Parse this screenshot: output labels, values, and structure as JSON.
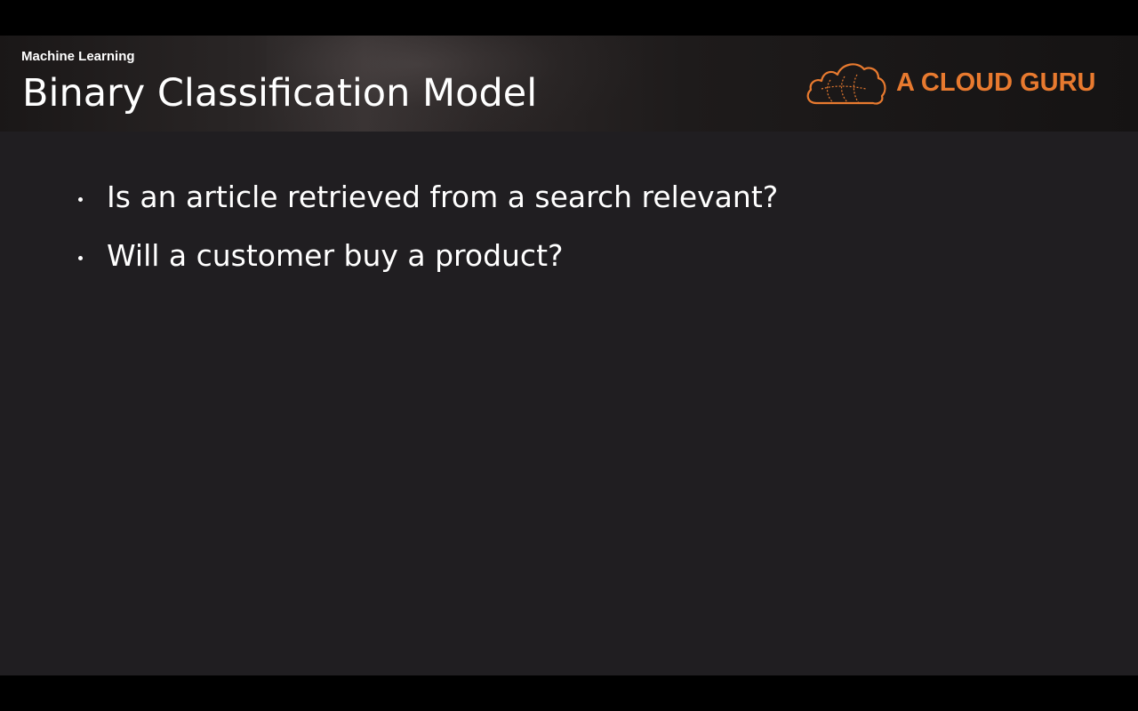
{
  "slide": {
    "course": "Machine Learning",
    "title": "Binary Classification Model",
    "brand": {
      "name": "A CLOUD GURU",
      "color": "#e87a2f",
      "icon": "cloud-logo-icon"
    },
    "bullets": [
      {
        "text": "Is an article retrieved from a search relevant?"
      },
      {
        "text": "Will a customer buy a product?"
      }
    ]
  },
  "colors": {
    "slide_background": "#201e21",
    "letterbox": "#000000",
    "text": "#ffffff"
  }
}
